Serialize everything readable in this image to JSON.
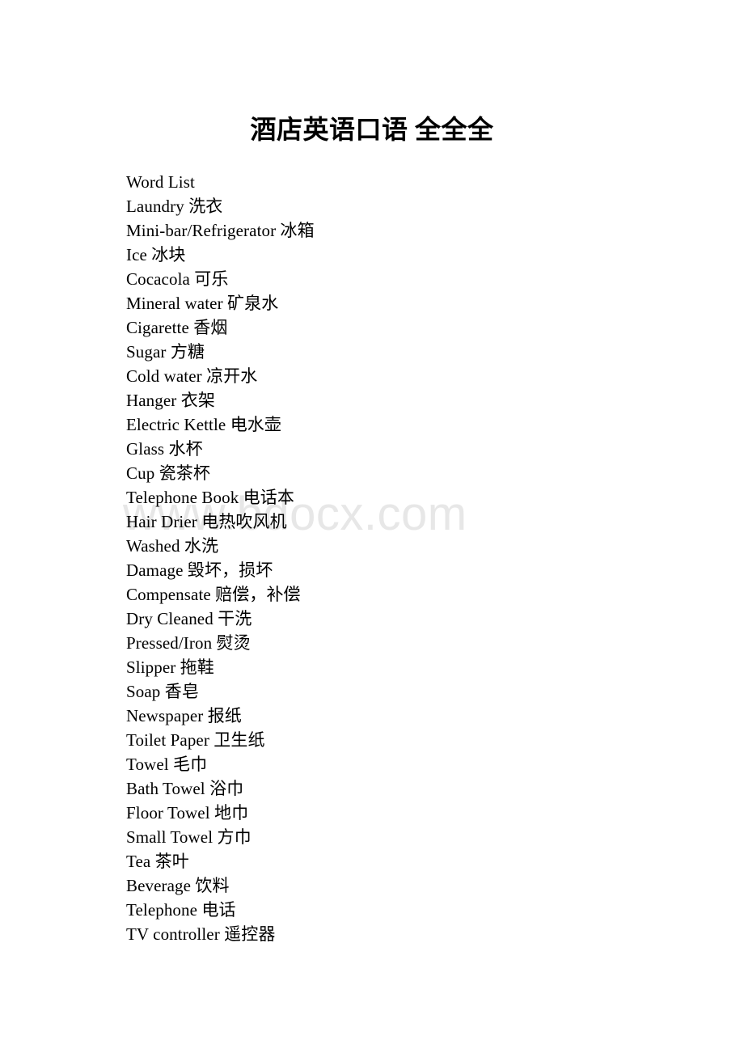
{
  "document": {
    "title": "酒店英语口语 全全全",
    "watermark": "www.bdocx.com",
    "background_color": "#ffffff",
    "text_color": "#000000",
    "watermark_color": "#e7e7e7"
  },
  "word_list": {
    "heading": "Word List",
    "lines": [
      "Word List",
      "Laundry 洗衣",
      "Mini-bar/Refrigerator 冰箱",
      "Ice 冰块",
      "Cocacola 可乐",
      "Mineral water 矿泉水",
      "Cigarette 香烟",
      "Sugar 方糖",
      "Cold water 凉开水",
      "Hanger 衣架",
      "Electric Kettle 电水壶",
      "Glass 水杯",
      "Cup 瓷茶杯",
      "Telephone Book 电话本",
      "Hair Drier 电热吹风机",
      "Washed 水洗",
      "Damage 毁坏，损坏",
      "Compensate 赔偿，补偿",
      "Dry Cleaned 干洗",
      "Pressed/Iron 熨烫",
      "Slipper 拖鞋",
      "Soap 香皂",
      "Newspaper 报纸",
      "Toilet Paper 卫生纸",
      "Towel 毛巾",
      "Bath Towel 浴巾",
      "Floor Towel 地巾",
      "Small Towel 方巾",
      "Tea 茶叶",
      "Beverage 饮料",
      "Telephone 电话",
      "TV controller 遥控器"
    ]
  }
}
